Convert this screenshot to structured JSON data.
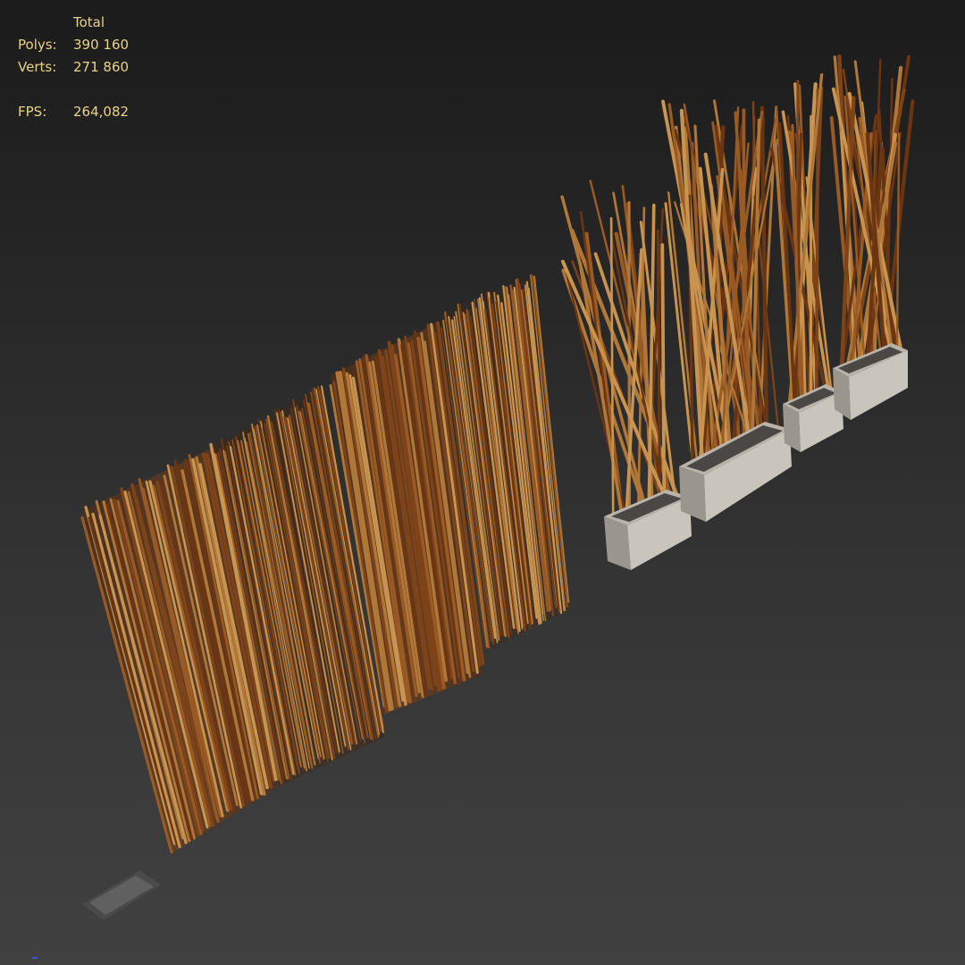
{
  "viewport_stats": {
    "header": "Total",
    "polys_label": "Polys:",
    "polys_value": "390 160",
    "verts_label": "Verts:",
    "verts_value": "271 860",
    "fps_label": "FPS:",
    "fps_value": "264,082"
  },
  "colors": {
    "stats_text": "#e8d389",
    "bamboo_dark": "#6b3512",
    "bamboo_mid": "#9a5a24",
    "bamboo_light": "#c89450",
    "planter_light": "#c9c4bc",
    "planter_dark": "#8f8a83",
    "background_top": "#1b1b1b",
    "background_bottom": "#414141"
  }
}
